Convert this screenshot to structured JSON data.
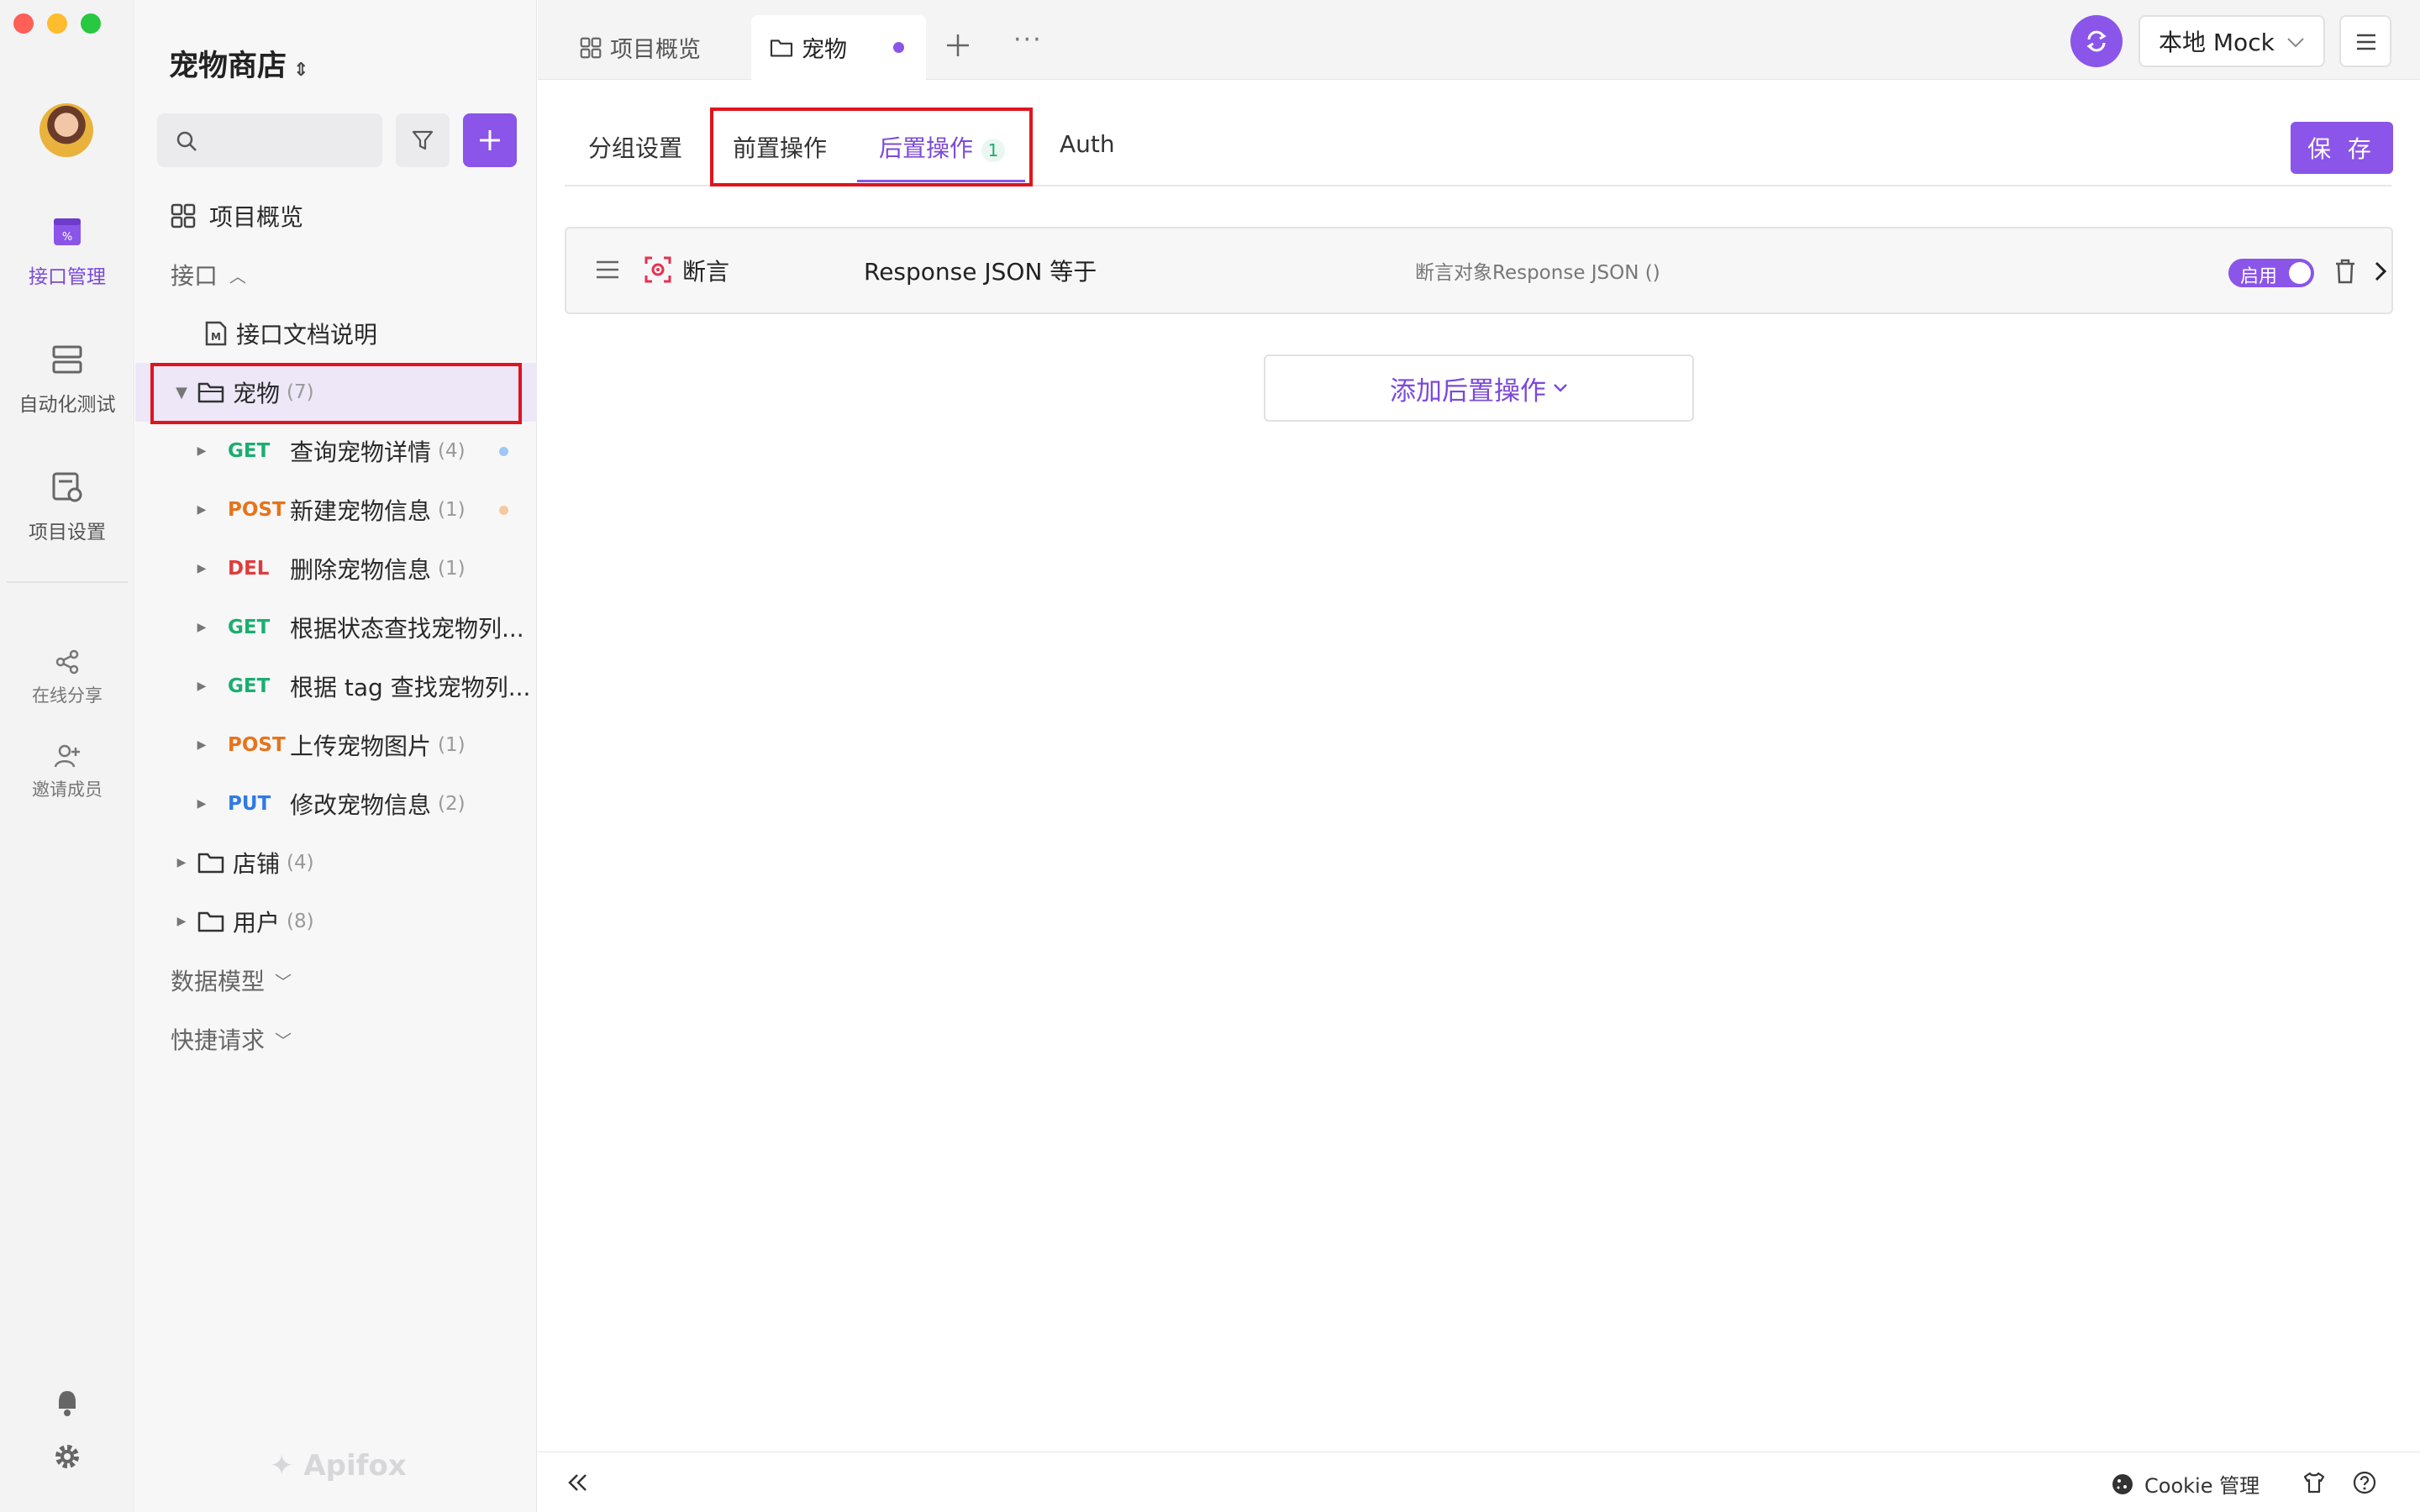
{
  "rail": {
    "nav": [
      {
        "label": "接口管理",
        "icon": "api-management-icon",
        "active": true
      },
      {
        "label": "自动化测试",
        "icon": "automation-test-icon",
        "active": false
      },
      {
        "label": "项目设置",
        "icon": "project-settings-icon",
        "active": false
      }
    ],
    "secondary": [
      {
        "label": "在线分享",
        "icon": "share-icon"
      },
      {
        "label": "邀请成员",
        "icon": "invite-member-icon"
      }
    ],
    "bottom_icons": [
      "bell-icon",
      "gear-icon"
    ]
  },
  "sidebar": {
    "project_title": "宠物商店",
    "search": {
      "value": "",
      "placeholder": ""
    },
    "overview_label": "项目概览",
    "api_section_label": "接口",
    "doc_label": "接口文档说明",
    "pet_folder": {
      "label": "宠物",
      "count": "(7)"
    },
    "endpoints": [
      {
        "method": "GET",
        "label": "查询宠物详情",
        "count": "(4)",
        "dot": "#9ec7f5"
      },
      {
        "method": "POST",
        "label": "新建宠物信息",
        "count": "(1)",
        "dot": "#f5c8a0"
      },
      {
        "method": "DEL",
        "label": "删除宠物信息",
        "count": "(1)",
        "dot": ""
      },
      {
        "method": "GET",
        "label": "根据状态查找宠物列...",
        "count": "",
        "dot": ""
      },
      {
        "method": "GET",
        "label": "根据 tag 查找宠物列...",
        "count": "",
        "dot": ""
      },
      {
        "method": "POST",
        "label": "上传宠物图片",
        "count": "(1)",
        "dot": ""
      },
      {
        "method": "PUT",
        "label": "修改宠物信息",
        "count": "(2)",
        "dot": ""
      }
    ],
    "store_folder": {
      "label": "店铺",
      "count": "(4)"
    },
    "user_folder": {
      "label": "用户",
      "count": "(8)"
    },
    "data_model_label": "数据模型",
    "quick_request_label": "快捷请求",
    "watermark": "Apifox"
  },
  "tabs": {
    "overview_tab": "项目概览",
    "pet_tab": "宠物"
  },
  "header": {
    "env_label": "本地 Mock"
  },
  "sub_tabs": {
    "group_settings": "分组设置",
    "pre_ops": "前置操作",
    "post_ops": "后置操作",
    "post_ops_count": "1",
    "auth": "Auth",
    "save": "保 存"
  },
  "assertion": {
    "type_label": "断言",
    "name": "Response JSON 等于",
    "target": "断言对象Response JSON ()",
    "toggle_label": "启用",
    "enabled": true
  },
  "add_post_label": "添加后置操作",
  "statusbar": {
    "cookie_label": "Cookie 管理"
  },
  "colors": {
    "accent": "#8a55e8",
    "get": "#1aae6f",
    "post": "#e8731a",
    "del": "#e03b3b",
    "put": "#2f7ae5",
    "highlight": "#e0141e"
  }
}
